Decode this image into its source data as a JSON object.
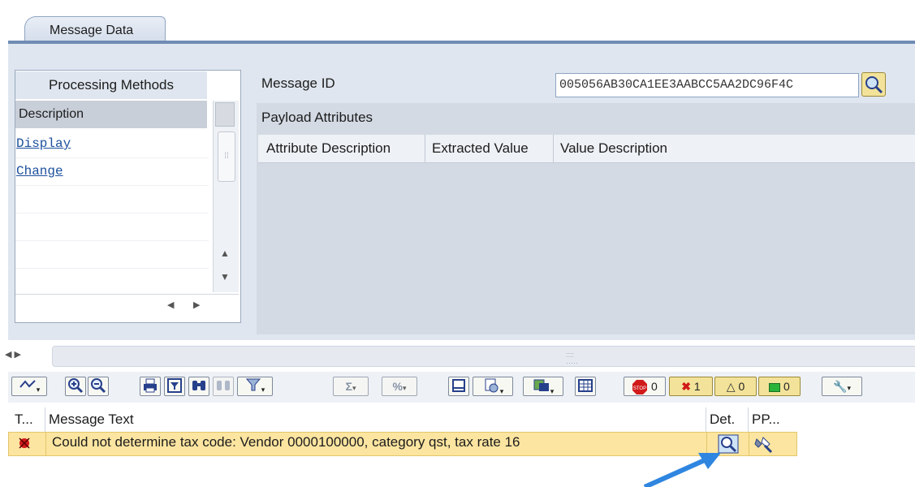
{
  "tabs": [
    {
      "label": "Message Data",
      "active": true
    }
  ],
  "processing_methods": {
    "title": "Processing Methods",
    "column_header": "Description",
    "items": [
      {
        "label": "Display"
      },
      {
        "label": "Change"
      }
    ]
  },
  "message_id": {
    "label": "Message ID",
    "value": "005056AB30CA1EE3AABCC5AA2DC96F4C"
  },
  "payload_attributes": {
    "title": "Payload Attributes",
    "columns": [
      "Attribute Description",
      "Extracted Value",
      "Value Description"
    ]
  },
  "toolbar": {
    "stop_count": "0",
    "error_count": "1",
    "warning_count": "0",
    "success_count": "0"
  },
  "message_table": {
    "columns": [
      "T...",
      "Message Text",
      "Det.",
      "PP..."
    ],
    "rows": [
      {
        "type": "error",
        "text": "Could not determine tax code: Vendor 0000100000, category qst, tax rate 16"
      }
    ]
  },
  "colors": {
    "panel": "#dfe6ef",
    "highlight_row": "#fce5a0",
    "selected_button": "#f3e39a",
    "error_red": "#d11a1a",
    "link": "#1b4f9c",
    "annotation_arrow": "#2f86e0"
  },
  "icons": [
    "search-icon",
    "zoom-in-icon",
    "zoom-out-icon",
    "print-icon",
    "filter-icon",
    "find-icon",
    "sum-icon",
    "stop-icon",
    "error-icon",
    "warning-icon",
    "success-icon",
    "settings-icon",
    "detail-icon",
    "tools-icon"
  ]
}
